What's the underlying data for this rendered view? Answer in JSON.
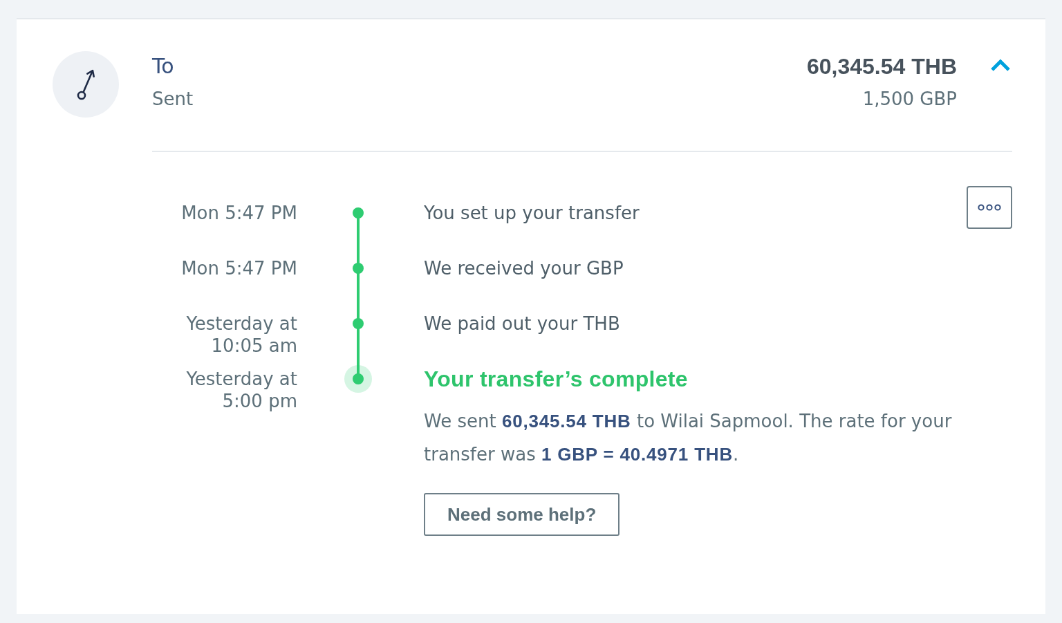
{
  "transfer": {
    "direction": "To",
    "status": "Sent",
    "amount": "60,345.54 THB",
    "source_amount": "1,500 GBP",
    "expanded": true
  },
  "timeline": [
    {
      "time": "Mon 5:47 PM",
      "event": "You set up your transfer",
      "current": false
    },
    {
      "time": "Mon 5:47 PM",
      "event": "We received your GBP",
      "current": false
    },
    {
      "time": "Yesterday at 10:05 am",
      "event": "We paid out your THB",
      "current": false
    },
    {
      "time": "Yesterday at 5:00 pm",
      "event": "Your transfer’s complete",
      "current": true,
      "description": "We sent **60,345.54 THB** to Wilai Sapmool. The rate for your transfer was **1 GBP = 40.4971 THB**.",
      "action": "Need some help?"
    }
  ]
}
